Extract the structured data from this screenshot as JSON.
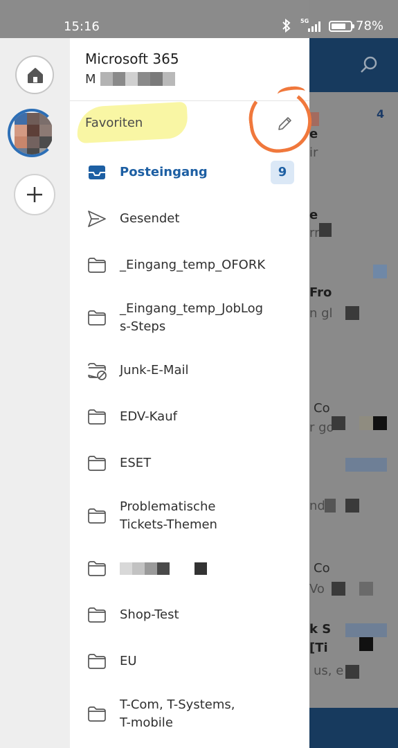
{
  "status_bar": {
    "time": "15:16",
    "network": "5G",
    "battery": "78%",
    "battery_level": 0.78,
    "icons": [
      "bluetooth-icon",
      "signal-icon",
      "battery-icon"
    ]
  },
  "rail": {
    "icons": [
      "home-icon",
      "avatar",
      "plus-icon"
    ]
  },
  "account": {
    "name": "Microsoft 365",
    "email_prefix": "M"
  },
  "favorites": {
    "label": "Favoriten",
    "edit_icon": "pencil-icon"
  },
  "folders": [
    {
      "label": "Posteingang",
      "icon": "inbox-icon",
      "badge": "9",
      "active": true
    },
    {
      "label": "Gesendet",
      "icon": "send-icon"
    },
    {
      "label": "_Eingang_temp_OFORK",
      "icon": "folder-icon"
    },
    {
      "label": "_Eingang_temp_JobLog\ns-Steps",
      "icon": "folder-icon"
    },
    {
      "label": "Junk-E-Mail",
      "icon": "junk-folder-icon"
    },
    {
      "label": "EDV-Kauf",
      "icon": "folder-icon"
    },
    {
      "label": "ESET",
      "icon": "folder-icon"
    },
    {
      "label": "Problematische\nTickets-Themen",
      "icon": "folder-icon"
    },
    {
      "label": "",
      "icon": "folder-icon",
      "redacted": true
    },
    {
      "label": "Shop-Test",
      "icon": "folder-icon"
    },
    {
      "label": "EU",
      "icon": "folder-icon"
    },
    {
      "label": "T-Com, T-Systems,\nT-mobile",
      "icon": "folder-icon"
    }
  ],
  "background": {
    "snippets": [
      "4",
      "e",
      "ir",
      "e",
      "rr",
      "Fro",
      "n gl",
      "Co",
      "r go",
      "nd",
      "Co",
      "Vo",
      "k S",
      "[Ti",
      "us, e"
    ]
  },
  "colors": {
    "accent": "#1d5fa3",
    "badge_bg": "#dbe8f6",
    "highlight_yellow": "#f8f59a",
    "annotation_orange": "#f0783c",
    "header_blue": "#173a5e"
  }
}
